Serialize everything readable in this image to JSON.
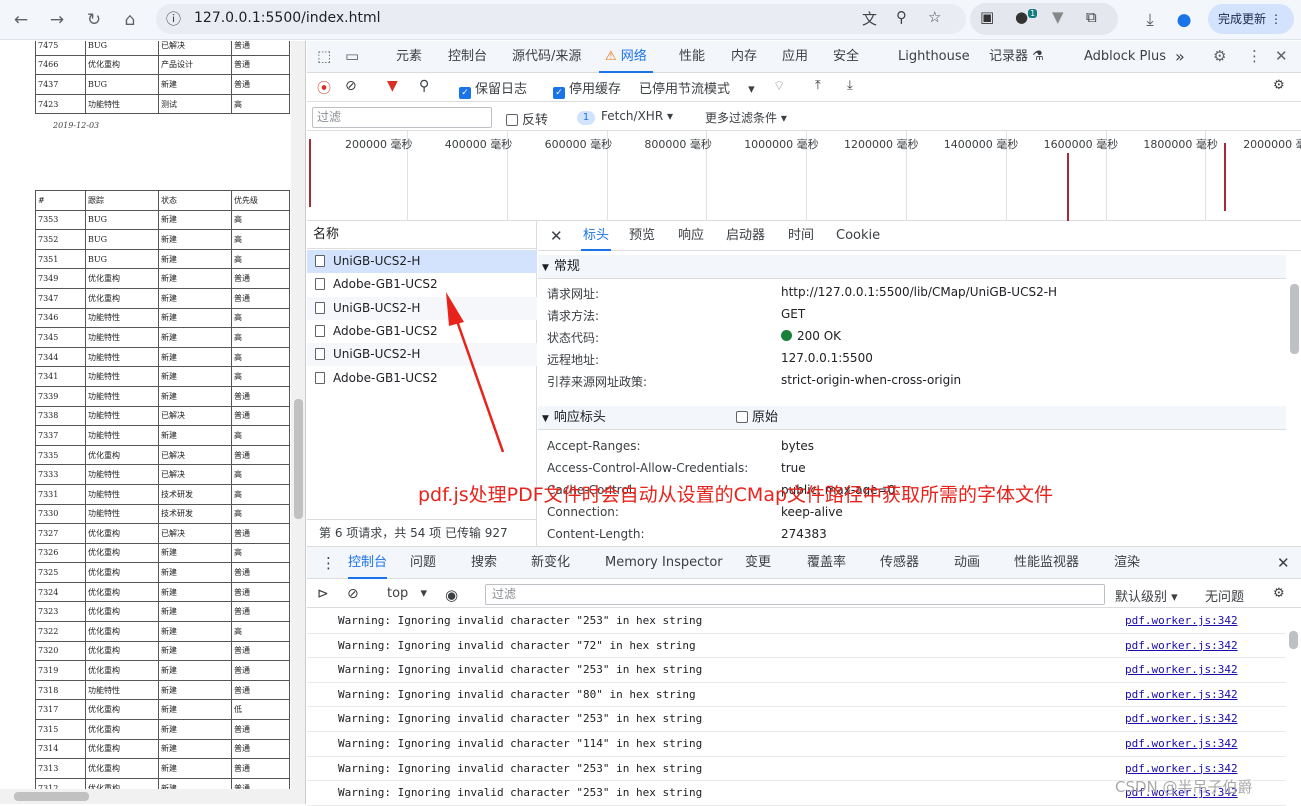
{
  "browser": {
    "url": "127.0.0.1:5500/index.html",
    "update_label": "完成更新",
    "ext_badge": "1",
    "icons": [
      "back-icon",
      "forward-icon",
      "reload-icon",
      "home-icon",
      "info-icon",
      "translate-icon",
      "zoom-icon",
      "star-icon",
      "extension-icon",
      "download-icon",
      "profile-icon",
      "menu-icon"
    ]
  },
  "pdf": {
    "top_rows": [
      [
        "7475",
        "BUG",
        "已解决",
        "普通"
      ],
      [
        "7466",
        "优化重构",
        "产品设计",
        "普通"
      ],
      [
        "7437",
        "BUG",
        "新建",
        "普通"
      ],
      [
        "7423",
        "功能特性",
        "测试",
        "高"
      ]
    ],
    "date": "2019-12-03",
    "headers": [
      "#",
      "跟踪",
      "状态",
      "优先级"
    ],
    "rows": [
      [
        "7353",
        "BUG",
        "新建",
        "高"
      ],
      [
        "7352",
        "BUG",
        "新建",
        "高"
      ],
      [
        "7351",
        "BUG",
        "新建",
        "高"
      ],
      [
        "7349",
        "优化重构",
        "新建",
        "普通"
      ],
      [
        "7347",
        "优化重构",
        "新建",
        "普通"
      ],
      [
        "7346",
        "功能特性",
        "新建",
        "高"
      ],
      [
        "7345",
        "功能特性",
        "新建",
        "高"
      ],
      [
        "7344",
        "功能特性",
        "新建",
        "高"
      ],
      [
        "7341",
        "功能特性",
        "新建",
        "高"
      ],
      [
        "7339",
        "功能特性",
        "新建",
        "普通"
      ],
      [
        "7338",
        "功能特性",
        "已解决",
        "普通"
      ],
      [
        "7337",
        "功能特性",
        "新建",
        "高"
      ],
      [
        "7335",
        "优化重构",
        "已解决",
        "普通"
      ],
      [
        "7333",
        "功能特性",
        "已解决",
        "高"
      ],
      [
        "7331",
        "功能特性",
        "技术研发",
        "高"
      ],
      [
        "7330",
        "功能特性",
        "技术研发",
        "高"
      ],
      [
        "7327",
        "优化重构",
        "已解决",
        "普通"
      ],
      [
        "7326",
        "优化重构",
        "新建",
        "高"
      ],
      [
        "7325",
        "优化重构",
        "新建",
        "普通"
      ],
      [
        "7324",
        "优化重构",
        "新建",
        "普通"
      ],
      [
        "7323",
        "优化重构",
        "新建",
        "普通"
      ],
      [
        "7322",
        "优化重构",
        "新建",
        "高"
      ],
      [
        "7320",
        "优化重构",
        "新建",
        "普通"
      ],
      [
        "7319",
        "优化重构",
        "新建",
        "普通"
      ],
      [
        "7318",
        "功能特性",
        "新建",
        "普通"
      ],
      [
        "7317",
        "优化重构",
        "新建",
        "低"
      ],
      [
        "7315",
        "优化重构",
        "新建",
        "普通"
      ],
      [
        "7314",
        "优化重构",
        "新建",
        "普通"
      ],
      [
        "7313",
        "优化重构",
        "新建",
        "普通"
      ],
      [
        "7312",
        "优化重构",
        "新建",
        "普通"
      ]
    ]
  },
  "devtools": {
    "tabs": [
      "元素",
      "控制台",
      "源代码/来源",
      "网络",
      "性能",
      "内存",
      "应用",
      "安全",
      "Lighthouse",
      "记录器 ⚗",
      "Adblock Plus"
    ],
    "more_tabs": "»",
    "network_toolbar": {
      "preserve_log": "保留日志",
      "disable_cache": "停用缓存",
      "throttle": "已停用节流模式"
    },
    "filter": {
      "placeholder": "过滤",
      "invert": "反转",
      "count": "1",
      "type": "Fetch/XHR",
      "more": "更多过滤条件"
    },
    "timeline": [
      "200000 毫秒",
      "400000 毫秒",
      "600000 毫秒",
      "800000 毫秒",
      "1000000 毫秒",
      "1200000 毫秒",
      "1400000 毫秒",
      "1600000 毫秒",
      "1800000 毫秒",
      "2000000 毫秒"
    ],
    "names_header": "名称",
    "requests": [
      "UniGB-UCS2-H",
      "Adobe-GB1-UCS2",
      "UniGB-UCS2-H",
      "Adobe-GB1-UCS2",
      "UniGB-UCS2-H",
      "Adobe-GB1-UCS2"
    ],
    "summary": "第 6 项请求，共 54 项  已传输 927",
    "detail_tabs": [
      "标头",
      "预览",
      "响应",
      "启动器",
      "时间",
      "Cookie"
    ],
    "general": {
      "title": "常规",
      "items": [
        {
          "k": "请求网址:",
          "v": "http://127.0.0.1:5500/lib/CMap/UniGB-UCS2-H"
        },
        {
          "k": "请求方法:",
          "v": "GET"
        },
        {
          "k": "状态代码:",
          "v": "200 OK"
        },
        {
          "k": "远程地址:",
          "v": "127.0.0.1:5500"
        },
        {
          "k": "引荐来源网址政策:",
          "v": "strict-origin-when-cross-origin"
        }
      ]
    },
    "response": {
      "title": "响应标头",
      "raw": "原始",
      "items": [
        {
          "k": "Accept-Ranges:",
          "v": "bytes"
        },
        {
          "k": "Access-Control-Allow-Credentials:",
          "v": "true"
        },
        {
          "k": "Cache-Control:",
          "v": "public, max-age=0"
        },
        {
          "k": "Connection:",
          "v": "keep-alive"
        },
        {
          "k": "Content-Length:",
          "v": "274383"
        }
      ]
    },
    "drawer_tabs": [
      "控制台",
      "问题",
      "搜索",
      "新变化",
      "Memory Inspector",
      "变更",
      "覆盖率",
      "传感器",
      "动画",
      "性能监视器",
      "渲染"
    ],
    "console_toolbar": {
      "context": "top",
      "filter_placeholder": "过滤",
      "levels": "默认级别",
      "issues": "无问题"
    },
    "console": [
      {
        "text": "Warning: Ignoring invalid character \"253\" in hex string",
        "src": "pdf.worker.js:342"
      },
      {
        "text": "Warning: Ignoring invalid character \"72\" in hex string",
        "src": "pdf.worker.js:342"
      },
      {
        "text": "Warning: Ignoring invalid character \"253\" in hex string",
        "src": "pdf.worker.js:342"
      },
      {
        "text": "Warning: Ignoring invalid character \"80\" in hex string",
        "src": "pdf.worker.js:342"
      },
      {
        "text": "Warning: Ignoring invalid character \"253\" in hex string",
        "src": "pdf.worker.js:342"
      },
      {
        "text": "Warning: Ignoring invalid character \"114\" in hex string",
        "src": "pdf.worker.js:342"
      },
      {
        "text": "Warning: Ignoring invalid character \"253\" in hex string",
        "src": "pdf.worker.js:342"
      },
      {
        "text": "Warning: Ignoring invalid character \"253\" in hex string",
        "src": "pdf.worker.js:342"
      }
    ]
  },
  "annotation": "pdf.js处理PDF文件时会自动从设置的CMap文件路径中获取所需的字体文件",
  "watermark": "CSDN @半吊子伯爵",
  "colors": {
    "accent": "#1a73e8",
    "annotation": "#e8231c",
    "record": "#d93025",
    "ok": "#188038"
  }
}
